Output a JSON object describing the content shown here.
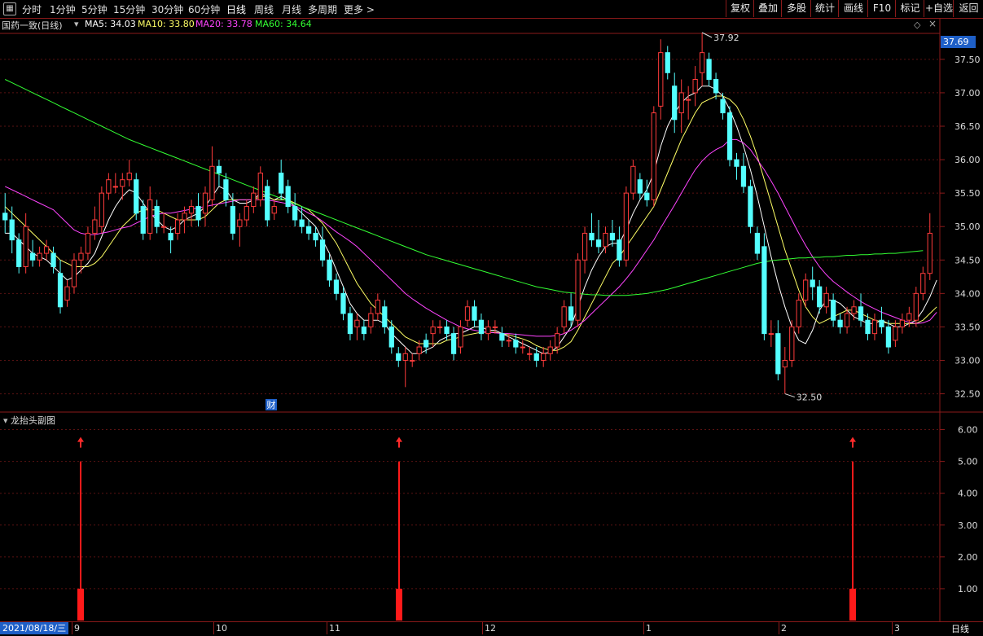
{
  "toolbar": {
    "periods": [
      "分时",
      "1分钟",
      "5分钟",
      "15分钟",
      "30分钟",
      "60分钟",
      "日线",
      "周线",
      "月线",
      "多周期",
      "更多 >"
    ],
    "active": "日线",
    "right_buttons": [
      "复权",
      "叠加",
      "多股",
      "统计",
      "画线",
      "F10",
      "标记",
      "+自选",
      "返回"
    ]
  },
  "info": {
    "name": "国药一致(日线)",
    "ma5": "MA5: 34.03",
    "ma10": "MA10: 33.80",
    "ma20": "MA20: 33.78",
    "ma60": "MA60: 34.64",
    "colors": {
      "ma5": "#ffffff",
      "ma10": "#ffff66",
      "ma20": "#ff44ff",
      "ma60": "#33ff33"
    }
  },
  "price_axis": {
    "current": "37.69",
    "ticks": [
      "37.50",
      "37.00",
      "36.50",
      "36.00",
      "35.50",
      "35.00",
      "34.50",
      "34.00",
      "33.50",
      "33.00",
      "32.50"
    ]
  },
  "annotations": {
    "high": "37.92",
    "low": "32.50",
    "event": "财"
  },
  "sub_chart": {
    "title": "龙抬头副图",
    "ticks": [
      "6.00",
      "5.00",
      "4.00",
      "3.00",
      "2.00",
      "1.00"
    ]
  },
  "x_axis": {
    "date": "2021/08/18/三",
    "labels": [
      "9",
      "10",
      "11",
      "12",
      "1",
      "2",
      "3"
    ],
    "period": "日线"
  },
  "chart_data": {
    "type": "candlestick",
    "ylim": [
      32.3,
      37.9
    ],
    "candles": [
      [
        35.2,
        35.5,
        34.9,
        35.1
      ],
      [
        35.1,
        35.3,
        34.6,
        34.8
      ],
      [
        34.8,
        34.9,
        34.3,
        34.4
      ],
      [
        34.4,
        35.2,
        34.3,
        35.0
      ],
      [
        34.6,
        34.8,
        34.4,
        34.5
      ],
      [
        34.5,
        34.7,
        34.4,
        34.6
      ],
      [
        34.6,
        34.8,
        34.5,
        34.7
      ],
      [
        34.6,
        34.7,
        34.3,
        34.4
      ],
      [
        34.3,
        34.5,
        33.7,
        33.8
      ],
      [
        33.9,
        34.2,
        33.8,
        34.1
      ],
      [
        34.1,
        34.6,
        34.0,
        34.5
      ],
      [
        34.5,
        34.7,
        34.3,
        34.6
      ],
      [
        34.6,
        35.0,
        34.5,
        34.9
      ],
      [
        34.9,
        35.3,
        34.8,
        35.1
      ],
      [
        35.0,
        35.6,
        34.9,
        35.5
      ],
      [
        35.5,
        35.8,
        35.4,
        35.7
      ],
      [
        35.6,
        35.8,
        35.5,
        35.6
      ],
      [
        35.6,
        35.8,
        35.4,
        35.7
      ],
      [
        35.7,
        36.0,
        35.6,
        35.8
      ],
      [
        35.7,
        35.8,
        35.1,
        35.2
      ],
      [
        35.3,
        35.4,
        34.8,
        34.9
      ],
      [
        34.9,
        35.6,
        34.8,
        35.4
      ],
      [
        35.3,
        35.4,
        34.9,
        35.0
      ],
      [
        35.0,
        35.2,
        34.9,
        35.0
      ],
      [
        34.9,
        35.0,
        34.6,
        34.8
      ],
      [
        34.9,
        35.2,
        34.8,
        35.1
      ],
      [
        35.1,
        35.3,
        34.9,
        35.2
      ],
      [
        35.2,
        35.4,
        35.0,
        35.3
      ],
      [
        35.3,
        35.5,
        35.0,
        35.1
      ],
      [
        35.2,
        35.6,
        35.0,
        35.5
      ],
      [
        35.4,
        36.2,
        35.3,
        35.9
      ],
      [
        35.9,
        36.0,
        35.6,
        35.8
      ],
      [
        35.7,
        35.8,
        35.3,
        35.4
      ],
      [
        35.3,
        35.5,
        34.8,
        34.9
      ],
      [
        35.0,
        35.2,
        34.7,
        35.1
      ],
      [
        35.1,
        35.4,
        35.0,
        35.3
      ],
      [
        35.3,
        35.6,
        35.2,
        35.5
      ],
      [
        35.4,
        35.9,
        35.3,
        35.8
      ],
      [
        35.6,
        35.7,
        35.0,
        35.1
      ],
      [
        35.2,
        35.4,
        35.1,
        35.3
      ],
      [
        35.8,
        36.0,
        35.4,
        35.5
      ],
      [
        35.6,
        35.7,
        35.2,
        35.3
      ],
      [
        35.3,
        35.5,
        35.0,
        35.1
      ],
      [
        35.1,
        35.3,
        34.9,
        35.0
      ],
      [
        35.0,
        35.1,
        34.8,
        34.9
      ],
      [
        34.9,
        35.0,
        34.7,
        34.8
      ],
      [
        34.8,
        35.0,
        34.4,
        34.5
      ],
      [
        34.5,
        34.6,
        34.1,
        34.2
      ],
      [
        34.2,
        34.3,
        33.9,
        34.0
      ],
      [
        34.0,
        34.1,
        33.6,
        33.7
      ],
      [
        33.7,
        33.8,
        33.3,
        33.4
      ],
      [
        33.5,
        33.7,
        33.3,
        33.6
      ],
      [
        33.5,
        33.6,
        33.3,
        33.4
      ],
      [
        33.5,
        33.8,
        33.4,
        33.7
      ],
      [
        33.7,
        34.0,
        33.6,
        33.9
      ],
      [
        33.8,
        33.9,
        33.4,
        33.5
      ],
      [
        33.5,
        33.6,
        33.1,
        33.2
      ],
      [
        33.1,
        33.2,
        32.9,
        33.0
      ],
      [
        33.0,
        33.2,
        32.6,
        33.1
      ],
      [
        33.0,
        33.1,
        32.9,
        33.0
      ],
      [
        33.1,
        33.3,
        33.0,
        33.2
      ],
      [
        33.3,
        33.4,
        33.1,
        33.2
      ],
      [
        33.4,
        33.6,
        33.2,
        33.5
      ],
      [
        33.5,
        33.6,
        33.4,
        33.5
      ],
      [
        33.5,
        33.6,
        33.3,
        33.4
      ],
      [
        33.4,
        33.5,
        33.0,
        33.1
      ],
      [
        33.2,
        33.6,
        33.1,
        33.5
      ],
      [
        33.6,
        33.9,
        33.5,
        33.8
      ],
      [
        33.8,
        33.9,
        33.5,
        33.6
      ],
      [
        33.6,
        33.7,
        33.3,
        33.4
      ],
      [
        33.4,
        33.6,
        33.3,
        33.5
      ],
      [
        33.5,
        33.6,
        33.4,
        33.5
      ],
      [
        33.4,
        33.5,
        33.2,
        33.3
      ],
      [
        33.3,
        33.4,
        33.2,
        33.3
      ],
      [
        33.3,
        33.4,
        33.1,
        33.2
      ],
      [
        33.2,
        33.3,
        33.1,
        33.2
      ],
      [
        33.1,
        33.2,
        33.0,
        33.1
      ],
      [
        33.1,
        33.2,
        32.9,
        33.0
      ],
      [
        33.0,
        33.2,
        32.9,
        33.1
      ],
      [
        33.1,
        33.3,
        33.0,
        33.2
      ],
      [
        33.2,
        33.5,
        33.1,
        33.4
      ],
      [
        33.5,
        33.9,
        33.4,
        33.8
      ],
      [
        33.8,
        34.0,
        33.5,
        33.6
      ],
      [
        33.6,
        34.6,
        33.5,
        34.5
      ],
      [
        34.5,
        35.0,
        34.3,
        34.9
      ],
      [
        34.9,
        35.2,
        34.7,
        34.8
      ],
      [
        34.8,
        35.1,
        34.6,
        34.7
      ],
      [
        34.7,
        35.0,
        34.6,
        34.9
      ],
      [
        34.9,
        35.1,
        34.7,
        34.8
      ],
      [
        34.8,
        35.0,
        34.4,
        34.5
      ],
      [
        34.5,
        35.6,
        34.4,
        35.5
      ],
      [
        35.5,
        36.0,
        35.4,
        35.9
      ],
      [
        35.7,
        35.8,
        35.4,
        35.5
      ],
      [
        35.5,
        35.7,
        35.3,
        35.4
      ],
      [
        35.4,
        36.8,
        35.3,
        36.7
      ],
      [
        36.8,
        37.8,
        36.6,
        37.6
      ],
      [
        37.6,
        37.7,
        37.2,
        37.3
      ],
      [
        37.1,
        37.3,
        36.4,
        36.6
      ],
      [
        36.7,
        37.2,
        36.4,
        37.0
      ],
      [
        36.9,
        37.1,
        36.6,
        36.9
      ],
      [
        37.0,
        37.4,
        36.8,
        37.2
      ],
      [
        37.3,
        37.9,
        37.1,
        37.6
      ],
      [
        37.5,
        37.6,
        37.1,
        37.2
      ],
      [
        37.2,
        37.3,
        36.9,
        37.0
      ],
      [
        36.9,
        37.0,
        36.6,
        36.7
      ],
      [
        36.7,
        36.8,
        35.9,
        36.0
      ],
      [
        36.0,
        36.1,
        35.7,
        35.9
      ],
      [
        35.9,
        36.1,
        35.5,
        35.6
      ],
      [
        35.6,
        35.7,
        34.9,
        35.0
      ],
      [
        34.9,
        35.0,
        34.5,
        34.6
      ],
      [
        34.7,
        34.9,
        33.3,
        33.4
      ],
      [
        33.4,
        33.6,
        33.2,
        33.4
      ],
      [
        33.4,
        33.6,
        32.7,
        32.8
      ],
      [
        32.9,
        33.2,
        32.5,
        33.0
      ],
      [
        33.0,
        33.6,
        32.9,
        33.5
      ],
      [
        33.5,
        34.0,
        33.4,
        33.9
      ],
      [
        33.9,
        34.3,
        33.8,
        34.2
      ],
      [
        34.2,
        34.4,
        33.9,
        34.1
      ],
      [
        34.1,
        34.2,
        33.7,
        33.8
      ],
      [
        33.8,
        34.1,
        33.7,
        34.0
      ],
      [
        33.9,
        34.0,
        33.5,
        33.6
      ],
      [
        33.6,
        33.7,
        33.4,
        33.5
      ],
      [
        33.5,
        33.8,
        33.4,
        33.7
      ],
      [
        33.7,
        33.9,
        33.6,
        33.8
      ],
      [
        33.8,
        34.0,
        33.5,
        33.6
      ],
      [
        33.6,
        33.7,
        33.3,
        33.4
      ],
      [
        33.4,
        33.7,
        33.3,
        33.6
      ],
      [
        33.6,
        33.8,
        33.4,
        33.5
      ],
      [
        33.5,
        33.6,
        33.1,
        33.2
      ],
      [
        33.3,
        33.6,
        33.2,
        33.5
      ],
      [
        33.5,
        33.7,
        33.4,
        33.6
      ],
      [
        33.6,
        33.8,
        33.5,
        33.7
      ],
      [
        33.6,
        34.1,
        33.5,
        34.0
      ],
      [
        34.0,
        34.4,
        33.9,
        34.3
      ],
      [
        34.3,
        35.2,
        34.2,
        34.9
      ]
    ],
    "ma": {
      "MA5": [
        34.9,
        34.9,
        34.8,
        34.7,
        34.6,
        34.55,
        34.5,
        34.4,
        34.3,
        34.2,
        34.25,
        34.35,
        34.45,
        34.6,
        34.85,
        35.1,
        35.3,
        35.45,
        35.55,
        35.5,
        35.35,
        35.2,
        35.1,
        35.0,
        34.95,
        35.0,
        35.1,
        35.15,
        35.2,
        35.3,
        35.45,
        35.6,
        35.55,
        35.4,
        35.35,
        35.35,
        35.4,
        35.5,
        35.45,
        35.4,
        35.45,
        35.4,
        35.3,
        35.2,
        35.1,
        35.0,
        34.8,
        34.6,
        34.35,
        34.1,
        33.85,
        33.7,
        33.6,
        33.6,
        33.6,
        33.55,
        33.4,
        33.3,
        33.2,
        33.1,
        33.1,
        33.15,
        33.2,
        33.3,
        33.35,
        33.4,
        33.4,
        33.45,
        33.5,
        33.5,
        33.45,
        33.45,
        33.4,
        33.35,
        33.3,
        33.25,
        33.2,
        33.15,
        33.1,
        33.12,
        33.2,
        33.35,
        33.5,
        33.8,
        34.1,
        34.35,
        34.55,
        34.7,
        34.75,
        34.75,
        34.95,
        35.2,
        35.4,
        35.55,
        35.8,
        36.2,
        36.5,
        36.7,
        36.85,
        36.95,
        37.0,
        37.1,
        37.1,
        37.05,
        36.95,
        36.75,
        36.5,
        36.2,
        35.85,
        35.45,
        35.0,
        34.55,
        34.15,
        33.8,
        33.5,
        33.3,
        33.25,
        33.45,
        33.75,
        33.9,
        33.9,
        33.85,
        33.75,
        33.65,
        33.6,
        33.55,
        33.55,
        33.6,
        33.55,
        33.5,
        33.5,
        33.55,
        33.6,
        33.75,
        33.95,
        34.2
      ],
      "MA10": [
        35.3,
        35.2,
        35.1,
        35.0,
        34.9,
        34.8,
        34.7,
        34.6,
        34.5,
        34.45,
        34.4,
        34.4,
        34.4,
        34.45,
        34.55,
        34.7,
        34.85,
        35.0,
        35.1,
        35.2,
        35.25,
        35.25,
        35.25,
        35.2,
        35.15,
        35.1,
        35.1,
        35.1,
        35.1,
        35.15,
        35.25,
        35.35,
        35.4,
        35.4,
        35.4,
        35.4,
        35.4,
        35.45,
        35.45,
        35.4,
        35.4,
        35.4,
        35.35,
        35.3,
        35.25,
        35.15,
        35.05,
        34.9,
        34.75,
        34.55,
        34.35,
        34.15,
        34.0,
        33.85,
        33.75,
        33.65,
        33.55,
        33.45,
        33.35,
        33.3,
        33.25,
        33.25,
        33.25,
        33.25,
        33.3,
        33.32,
        33.35,
        33.38,
        33.4,
        33.42,
        33.42,
        33.42,
        33.4,
        33.38,
        33.35,
        33.32,
        33.28,
        33.22,
        33.18,
        33.15,
        33.15,
        33.2,
        33.28,
        33.45,
        33.65,
        33.85,
        34.05,
        34.25,
        34.45,
        34.55,
        34.7,
        34.85,
        35.0,
        35.15,
        35.3,
        35.55,
        35.8,
        36.05,
        36.3,
        36.5,
        36.7,
        36.85,
        36.9,
        36.95,
        36.95,
        36.9,
        36.8,
        36.6,
        36.35,
        36.05,
        35.7,
        35.35,
        35.0,
        34.65,
        34.35,
        34.05,
        33.8,
        33.65,
        33.55,
        33.6,
        33.65,
        33.7,
        33.75,
        33.75,
        33.7,
        33.65,
        33.6,
        33.58,
        33.55,
        33.55,
        33.55,
        33.55,
        33.55,
        33.6,
        33.7,
        33.8
      ],
      "MA20": [
        35.6,
        35.55,
        35.5,
        35.45,
        35.4,
        35.35,
        35.3,
        35.25,
        35.15,
        35.05,
        34.95,
        34.9,
        34.88,
        34.88,
        34.9,
        34.92,
        34.95,
        34.98,
        35.0,
        35.05,
        35.1,
        35.15,
        35.18,
        35.2,
        35.2,
        35.22,
        35.24,
        35.26,
        35.28,
        35.3,
        35.32,
        35.34,
        35.36,
        35.38,
        35.4,
        35.4,
        35.4,
        35.4,
        35.4,
        35.38,
        35.36,
        35.34,
        35.3,
        35.26,
        35.2,
        35.15,
        35.08,
        35.0,
        34.92,
        34.85,
        34.78,
        34.7,
        34.6,
        34.5,
        34.4,
        34.3,
        34.2,
        34.1,
        34.0,
        33.92,
        33.85,
        33.78,
        33.72,
        33.66,
        33.6,
        33.55,
        33.5,
        33.47,
        33.45,
        33.43,
        33.42,
        33.41,
        33.4,
        33.4,
        33.39,
        33.38,
        33.37,
        33.36,
        33.36,
        33.36,
        33.37,
        33.4,
        33.45,
        33.52,
        33.6,
        33.7,
        33.8,
        33.9,
        34.0,
        34.1,
        34.22,
        34.35,
        34.5,
        34.65,
        34.8,
        34.98,
        35.15,
        35.32,
        35.5,
        35.68,
        35.85,
        35.98,
        36.08,
        36.15,
        36.2,
        36.3,
        36.3,
        36.25,
        36.15,
        36.0,
        35.85,
        35.68,
        35.5,
        35.3,
        35.1,
        34.9,
        34.72,
        34.55,
        34.4,
        34.28,
        34.18,
        34.1,
        34.02,
        33.95,
        33.88,
        33.82,
        33.77,
        33.72,
        33.68,
        33.64,
        33.6,
        33.57,
        33.55,
        33.56,
        33.6,
        33.72
      ],
      "MA60": [
        37.2,
        37.15,
        37.1,
        37.05,
        37.0,
        36.95,
        36.9,
        36.85,
        36.8,
        36.75,
        36.7,
        36.65,
        36.6,
        36.55,
        36.5,
        36.45,
        36.4,
        36.35,
        36.3,
        36.26,
        36.22,
        36.18,
        36.14,
        36.1,
        36.06,
        36.02,
        35.98,
        35.94,
        35.9,
        35.86,
        35.82,
        35.78,
        35.74,
        35.7,
        35.66,
        35.62,
        35.58,
        35.54,
        35.5,
        35.46,
        35.42,
        35.38,
        35.34,
        35.3,
        35.26,
        35.22,
        35.18,
        35.14,
        35.1,
        35.06,
        35.02,
        34.98,
        34.94,
        34.9,
        34.86,
        34.82,
        34.78,
        34.74,
        34.7,
        34.66,
        34.62,
        34.58,
        34.55,
        34.52,
        34.49,
        34.46,
        34.43,
        34.4,
        34.37,
        34.34,
        34.31,
        34.28,
        34.25,
        34.22,
        34.19,
        34.16,
        34.13,
        34.1,
        34.08,
        34.06,
        34.04,
        34.02,
        34.01,
        34.0,
        33.99,
        33.98,
        33.98,
        33.97,
        33.97,
        33.97,
        33.97,
        33.98,
        33.99,
        34.0,
        34.02,
        34.04,
        34.06,
        34.09,
        34.12,
        34.15,
        34.18,
        34.21,
        34.24,
        34.27,
        34.3,
        34.33,
        34.36,
        34.39,
        34.42,
        34.45,
        34.47,
        34.49,
        34.5,
        34.51,
        34.52,
        34.53,
        34.53,
        34.54,
        34.54,
        34.55,
        34.55,
        34.56,
        34.57,
        34.57,
        34.58,
        34.58,
        34.59,
        34.59,
        34.6,
        34.6,
        34.61,
        34.62,
        34.63,
        34.64
      ]
    },
    "sub_signals": [
      {
        "index": 13,
        "value": 5
      },
      {
        "index": 67,
        "value": 5
      },
      {
        "index": 144,
        "value": 5
      }
    ],
    "sub_ylim": [
      0,
      6.5
    ]
  }
}
